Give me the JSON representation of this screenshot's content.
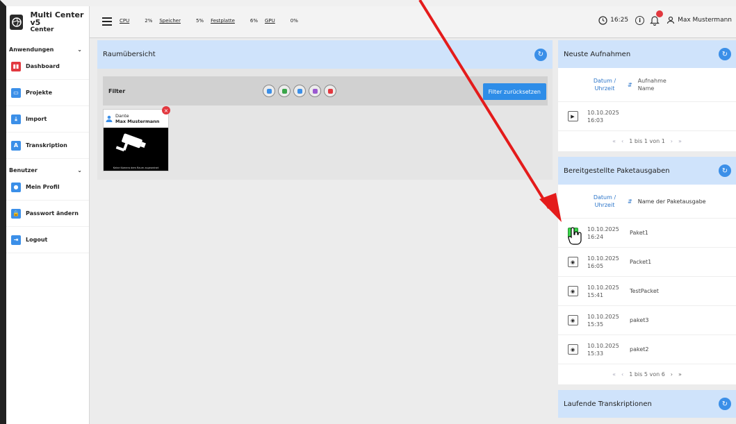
{
  "app": {
    "title": "Multi Center v5",
    "subtitle": "Center"
  },
  "topbar": {
    "stats": [
      {
        "label": "CPU",
        "value": "2%"
      },
      {
        "label": "Speicher",
        "value": "5%"
      },
      {
        "label": "Festplatte",
        "value": "6%"
      },
      {
        "label": "GPU",
        "value": "0%"
      }
    ],
    "time": "16:25",
    "user": "Max Mustermann"
  },
  "sidebar": {
    "sections": [
      {
        "title": "Anwendungen",
        "items": [
          {
            "label": "Dashboard",
            "color": "#e2383f"
          },
          {
            "label": "Projekte",
            "color": "#3b8fe8"
          },
          {
            "label": "Import",
            "color": "#3b8fe8"
          },
          {
            "label": "Transkription",
            "color": "#3b8fe8"
          }
        ]
      },
      {
        "title": "Benutzer",
        "items": [
          {
            "label": "Mein Profil",
            "color": "#3b8fe8"
          },
          {
            "label": "Passwort ändern",
            "color": "#3b8fe8"
          },
          {
            "label": "Logout",
            "color": "#3b8fe8"
          }
        ]
      }
    ]
  },
  "main": {
    "title": "Raumübersicht",
    "filter_label": "Filter",
    "filter_reset": "Filter zurücksetzen",
    "filter_icon_colors": [
      "#3b8fe8",
      "#3aa54a",
      "#3b8fe8",
      "#9b59d0",
      "#e2383f"
    ],
    "camera": {
      "name": "Dante",
      "user": "Max Mustermann",
      "caption": "Keine Kamera dem Raum zugeordnet"
    }
  },
  "recordings": {
    "title": "Neuste Aufnahmen",
    "col_date": "Datum / Uhrzeit",
    "col_name": "Aufnahme Name",
    "rows": [
      {
        "date": "10.10.2025",
        "time": "16:03",
        "name": ""
      }
    ],
    "pager": "1 bis 1 von 1"
  },
  "packages": {
    "title": "Bereitgestellte Paketausgaben",
    "col_date": "Datum / Uhrzeit",
    "col_name": "Name der Paketausgabe",
    "rows": [
      {
        "date": "10.10.2025",
        "time": "16:24",
        "name": "Paket1"
      },
      {
        "date": "10.10.2025",
        "time": "16:05",
        "name": "Packet1"
      },
      {
        "date": "10.10.2025",
        "time": "15:41",
        "name": "TestPacket"
      },
      {
        "date": "10.10.2025",
        "time": "15:35",
        "name": "paket3"
      },
      {
        "date": "10.10.2025",
        "time": "15:33",
        "name": "paket2"
      }
    ],
    "pager": "1 bis 5 von 6"
  },
  "transcriptions": {
    "title": "Laufende Transkriptionen"
  }
}
